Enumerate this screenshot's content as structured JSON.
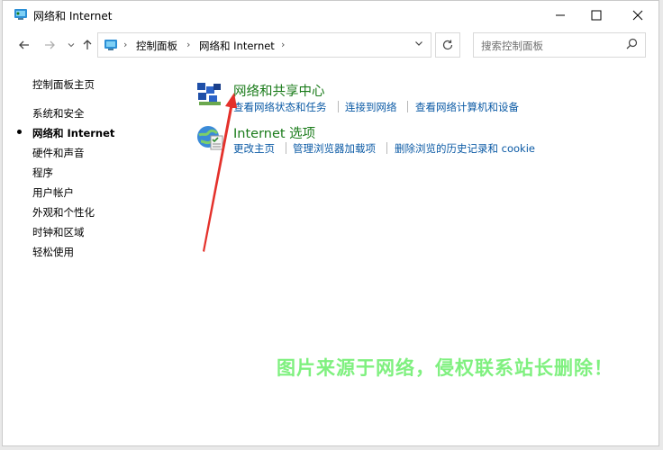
{
  "window": {
    "title": "网络和 Internet",
    "minimize_icon": "minimize-icon",
    "maximize_icon": "maximize-icon",
    "close_icon": "close-icon"
  },
  "navbar": {
    "breadcrumb": [
      "控制面板",
      "网络和 Internet"
    ],
    "search_placeholder": "搜索控制面板"
  },
  "sidebar": {
    "items": [
      {
        "label": "控制面板主页",
        "active": false
      },
      {
        "label": "系统和安全",
        "active": false
      },
      {
        "label": "网络和 Internet",
        "active": true
      },
      {
        "label": "硬件和声音",
        "active": false
      },
      {
        "label": "程序",
        "active": false
      },
      {
        "label": "用户帐户",
        "active": false
      },
      {
        "label": "外观和个性化",
        "active": false
      },
      {
        "label": "时钟和区域",
        "active": false
      },
      {
        "label": "轻松使用",
        "active": false
      }
    ]
  },
  "categories": [
    {
      "title": "网络和共享中心",
      "icon": "network-sharing-icon",
      "tasks": [
        "查看网络状态和任务",
        "连接到网络",
        "查看网络计算机和设备"
      ]
    },
    {
      "title": "Internet 选项",
      "icon": "internet-options-icon",
      "tasks": [
        "更改主页",
        "管理浏览器加载项",
        "删除浏览的历史记录和 cookie"
      ]
    }
  ],
  "watermark": "图片来源于网络，侵权联系站长删除！",
  "colors": {
    "category_title": "#1a7b1a",
    "task_link": "#0b5aa5",
    "annotation_arrow": "#e4312b",
    "watermark": "#7ff07f"
  }
}
